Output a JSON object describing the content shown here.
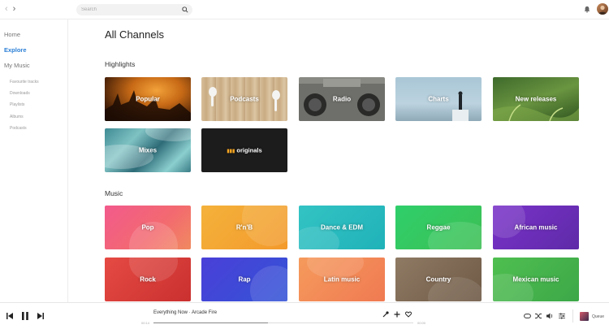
{
  "search": {
    "placeholder": "Search"
  },
  "sidebar": {
    "main": [
      {
        "label": "Home"
      },
      {
        "label": "Explore"
      },
      {
        "label": "My Music"
      }
    ],
    "sub": [
      {
        "label": "Favourite tracks"
      },
      {
        "label": "Downloads"
      },
      {
        "label": "Playlists"
      },
      {
        "label": "Albums"
      },
      {
        "label": "Podcasts"
      }
    ]
  },
  "main": {
    "title": "All Channels",
    "highlights": {
      "title": "Highlights",
      "tiles": [
        {
          "label": "Popular"
        },
        {
          "label": "Podcasts"
        },
        {
          "label": "Radio"
        },
        {
          "label": "Charts"
        },
        {
          "label": "New releases"
        },
        {
          "label": "Mixes"
        },
        {
          "label": "originals"
        }
      ]
    },
    "music": {
      "title": "Music",
      "tiles": [
        {
          "label": "Pop"
        },
        {
          "label": "R'n'B"
        },
        {
          "label": "Dance & EDM"
        },
        {
          "label": "Reggae"
        },
        {
          "label": "African music"
        },
        {
          "label": "Rock"
        },
        {
          "label": "Rap"
        },
        {
          "label": "Latin music"
        },
        {
          "label": "Country"
        },
        {
          "label": "Mexican music"
        }
      ]
    }
  },
  "player": {
    "track": "Everything Now · Arcade Fire",
    "elapsed": "00:14",
    "duration": "00:00",
    "progress_fraction": 0.44,
    "queue_label": "Queue"
  },
  "colors": {
    "accent": "#2b7fd6"
  }
}
